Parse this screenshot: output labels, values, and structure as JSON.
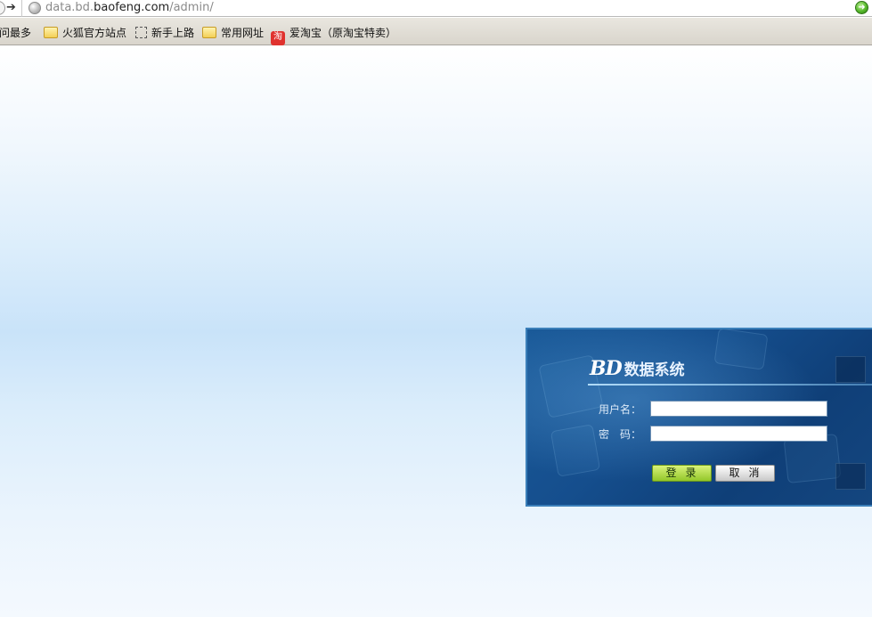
{
  "browser": {
    "url_prefix": "data.bd.",
    "url_host": "baofeng.com",
    "url_path": "/admin/",
    "bookmarks": [
      {
        "label": "访问最多",
        "icon": "none"
      },
      {
        "label": "火狐官方站点",
        "icon": "folder-icon"
      },
      {
        "label": "新手上路",
        "icon": "dotted-page-icon"
      },
      {
        "label": "常用网址",
        "icon": "folder-icon"
      },
      {
        "label": "爱淘宝（原淘宝特卖）",
        "icon": "taobao-icon",
        "icon_glyph": "淘"
      }
    ]
  },
  "login": {
    "brand_mark": "BD",
    "brand_name": "数据系统",
    "username_label": "用户名：",
    "password_label": "密　码：",
    "username_value": "",
    "password_value": "",
    "login_button": "登录",
    "cancel_button": "取消"
  },
  "colors": {
    "panel_blue": "#154e8d",
    "login_button_green": "#93c72a",
    "page_band_blue": "#c9e3f9"
  }
}
